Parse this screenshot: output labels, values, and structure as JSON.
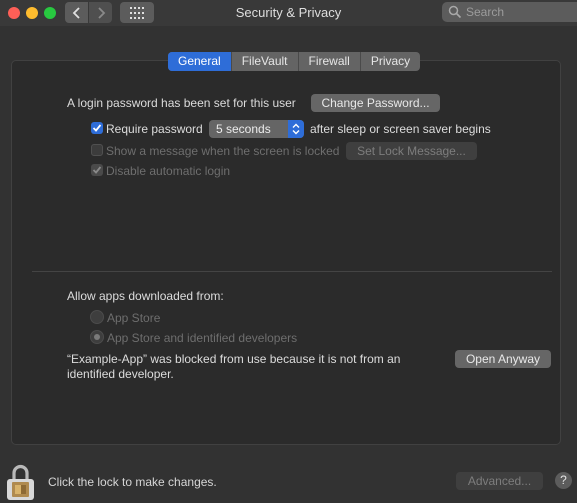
{
  "window": {
    "title": "Security & Privacy"
  },
  "search": {
    "placeholder": "Search"
  },
  "tabs": [
    {
      "label": "General",
      "active": true
    },
    {
      "label": "FileVault",
      "active": false
    },
    {
      "label": "Firewall",
      "active": false
    },
    {
      "label": "Privacy",
      "active": false
    }
  ],
  "general": {
    "login_password_text": "A login password has been set for this user",
    "change_password_label": "Change Password...",
    "require_password_label": "Require password",
    "require_password_checked": true,
    "require_password_delay": "5 seconds",
    "require_password_suffix": "after sleep or screen saver begins",
    "show_message_label": "Show a message when the screen is locked",
    "show_message_checked": false,
    "set_lock_message_label": "Set Lock Message...",
    "disable_auto_login_label": "Disable automatic login",
    "disable_auto_login_checked": true
  },
  "allow_apps": {
    "heading": "Allow apps downloaded from:",
    "options": [
      {
        "label": "App Store",
        "selected": false
      },
      {
        "label": "App Store and identified developers",
        "selected": true
      }
    ],
    "blocked_message": "“Example-App” was blocked from use because it is not from an identified developer.",
    "open_anyway_label": "Open Anyway"
  },
  "footer": {
    "lock_text": "Click the lock to make changes.",
    "advanced_label": "Advanced...",
    "help_label": "?"
  },
  "colors": {
    "accent": "#2e6dd8",
    "close": "#fe5f57",
    "minimize": "#febc2e",
    "maximize": "#28c840"
  },
  "icons": [
    "back-icon",
    "forward-icon",
    "grid-icon",
    "search-icon",
    "checkmark-icon",
    "chevron-updown-icon",
    "lock-icon",
    "help-icon"
  ]
}
